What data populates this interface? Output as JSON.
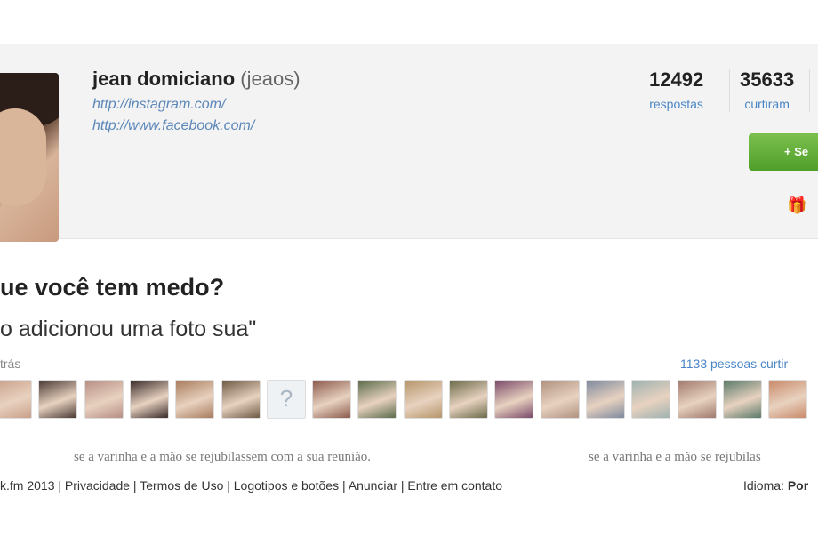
{
  "profile": {
    "name": "jean domiciano",
    "handle": "(jeaos)",
    "links": [
      "http://instagram.com/",
      "http://www.facebook.com/"
    ],
    "stats": [
      {
        "value": "12492",
        "label": "respostas"
      },
      {
        "value": "35633",
        "label": "curtiram"
      }
    ],
    "follow_label": "+ Se",
    "gift_icon": "gift-icon"
  },
  "post": {
    "question": "ue você tem medo?",
    "answer": "o adicionou uma foto sua\"",
    "time_ago": "trás",
    "likes": "1133 pessoas curtir"
  },
  "thumbs": [
    {
      "color": "#c9a08a"
    },
    {
      "color": "#4a3a34"
    },
    {
      "color": "#b78e85"
    },
    {
      "color": "#3a2b2b"
    },
    {
      "color": "#a87c5d"
    },
    {
      "color": "#6d5a44"
    },
    {
      "color": "placeholder",
      "glyph": "?"
    },
    {
      "color": "#8c5a4d"
    },
    {
      "color": "#5a6b4a"
    },
    {
      "color": "#b5966a"
    },
    {
      "color": "#6b6b4a"
    },
    {
      "color": "#7a4a6a"
    },
    {
      "color": "#b09280"
    },
    {
      "color": "#7e8a9e"
    },
    {
      "color": "#9fb2b0"
    },
    {
      "color": "#a07a6e"
    },
    {
      "color": "#5a7a6a"
    },
    {
      "color": "#c98a6a"
    }
  ],
  "blurred_text": [
    "se a varinha e a mão se rejubilassem com a sua reunião.",
    "se a varinha e a mão se rejubilas"
  ],
  "footer": {
    "text": "k.fm 2013 | Privacidade | Termos de Uso | Logotipos e botões | Anunciar | Entre em contato",
    "lang_label": "Idioma:",
    "lang_value": "Por"
  }
}
